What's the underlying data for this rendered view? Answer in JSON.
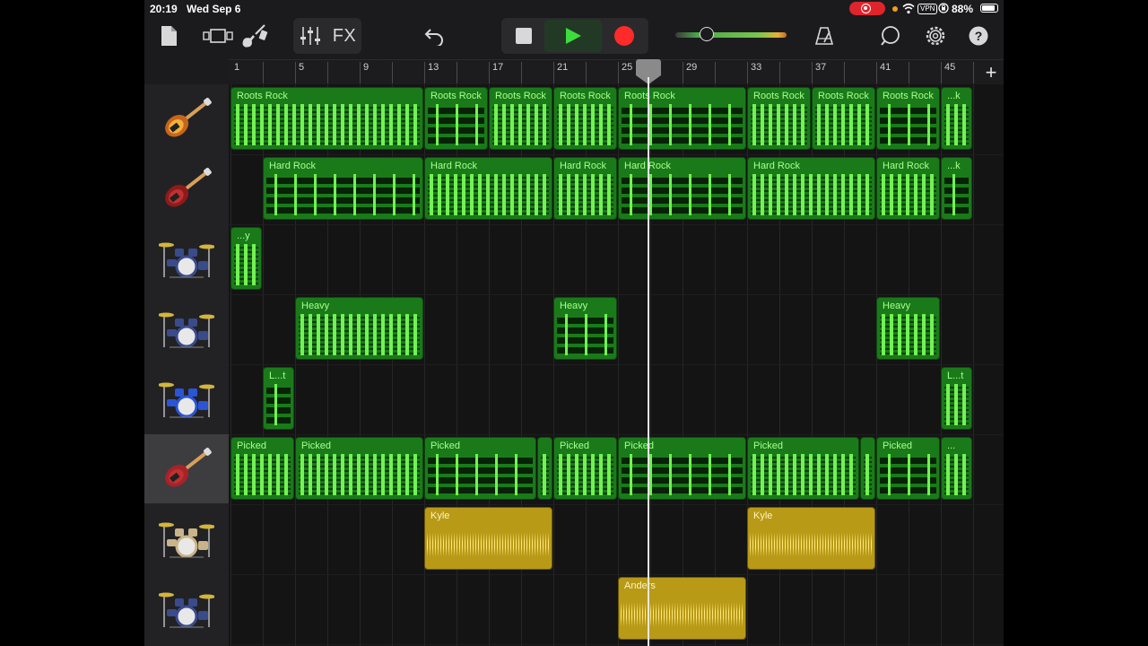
{
  "status_bar": {
    "time": "20:19",
    "date": "Wed Sep 6",
    "vpn_label": "VPN",
    "battery_percent": "88%",
    "battery_level": 0.88
  },
  "toolbar": {
    "fx_label": "FX",
    "master_volume": 0.22,
    "colors": {
      "play": "#3ddc3d",
      "record": "#ff2a2a"
    }
  },
  "ruler": {
    "bar_numbers": [
      "1",
      "5",
      "9",
      "13",
      "17",
      "21",
      "25",
      "29",
      "33",
      "37",
      "41",
      "45"
    ],
    "add_label": "+"
  },
  "tracks": [
    {
      "instrument": "electric-guitar-sunburst-icon",
      "regions": [
        {
          "name": "Roots Rock",
          "start": 1,
          "end": 13
        },
        {
          "name": "Roots Rock",
          "start": 13,
          "end": 17
        },
        {
          "name": "Roots Rock",
          "start": 17,
          "end": 21
        },
        {
          "name": "Roots Rock",
          "start": 21,
          "end": 25
        },
        {
          "name": "Roots Rock",
          "start": 25,
          "end": 33
        },
        {
          "name": "Roots Rock",
          "start": 33,
          "end": 37
        },
        {
          "name": "Roots Rock",
          "start": 37,
          "end": 41
        },
        {
          "name": "Roots Rock",
          "start": 41,
          "end": 45
        },
        {
          "name": "...k",
          "start": 45,
          "end": 47
        }
      ]
    },
    {
      "instrument": "electric-guitar-red-icon",
      "regions": [
        {
          "name": "Hard Rock",
          "start": 3,
          "end": 13
        },
        {
          "name": "Hard Rock",
          "start": 13,
          "end": 21
        },
        {
          "name": "Hard Rock",
          "start": 21,
          "end": 25
        },
        {
          "name": "Hard Rock",
          "start": 25,
          "end": 33
        },
        {
          "name": "Hard Rock",
          "start": 33,
          "end": 41
        },
        {
          "name": "Hard Rock",
          "start": 41,
          "end": 45
        },
        {
          "name": "...k",
          "start": 45,
          "end": 47
        }
      ]
    },
    {
      "instrument": "drum-kit-icon",
      "regions": [
        {
          "name": "...y",
          "start": 1,
          "end": 3
        }
      ]
    },
    {
      "instrument": "drum-kit-icon",
      "regions": [
        {
          "name": "Heavy",
          "start": 5,
          "end": 13
        },
        {
          "name": "Heavy",
          "start": 21,
          "end": 25
        },
        {
          "name": "Heavy",
          "start": 41,
          "end": 45
        }
      ]
    },
    {
      "instrument": "drum-kit-blue-icon",
      "regions": [
        {
          "name": "L...t",
          "start": 3,
          "end": 5
        },
        {
          "name": "L...t",
          "start": 45,
          "end": 47
        }
      ]
    },
    {
      "instrument": "bass-guitar-icon",
      "selected": true,
      "regions": [
        {
          "name": "Picked",
          "start": 1,
          "end": 5
        },
        {
          "name": "Picked",
          "start": 5,
          "end": 13
        },
        {
          "name": "Picked",
          "start": 13,
          "end": 20
        },
        {
          "name": "",
          "start": 20,
          "end": 21
        },
        {
          "name": "Picked",
          "start": 21,
          "end": 25
        },
        {
          "name": "Picked",
          "start": 25,
          "end": 33
        },
        {
          "name": "Picked",
          "start": 33,
          "end": 40
        },
        {
          "name": "",
          "start": 40,
          "end": 41
        },
        {
          "name": "Picked",
          "start": 41,
          "end": 45
        },
        {
          "name": "...",
          "start": 45,
          "end": 47
        }
      ]
    },
    {
      "instrument": "drum-kit-natural-icon",
      "audio": true,
      "regions": [
        {
          "name": "Kyle",
          "start": 13,
          "end": 21
        },
        {
          "name": "Kyle",
          "start": 33,
          "end": 41
        }
      ]
    },
    {
      "instrument": "drum-kit-icon",
      "audio": true,
      "regions": [
        {
          "name": "Anders",
          "start": 25,
          "end": 33
        }
      ]
    }
  ],
  "playhead_bar": 26.9
}
